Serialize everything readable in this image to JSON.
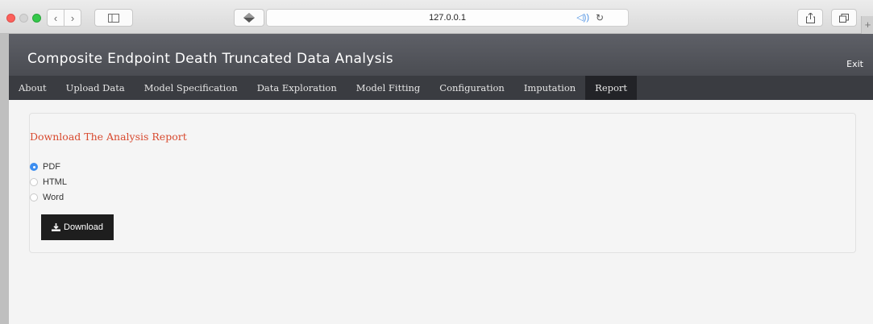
{
  "browser": {
    "url": "127.0.0.1"
  },
  "app": {
    "title": "Composite Endpoint Death Truncated Data Analysis",
    "exit_label": "Exit",
    "tabs": [
      {
        "label": "About"
      },
      {
        "label": "Upload Data"
      },
      {
        "label": "Model Specification"
      },
      {
        "label": "Data Exploration"
      },
      {
        "label": "Model Fitting"
      },
      {
        "label": "Configuration"
      },
      {
        "label": "Imputation"
      },
      {
        "label": "Report",
        "active": true
      }
    ]
  },
  "report": {
    "title": "Download The Analysis Report",
    "options": [
      {
        "label": "PDF",
        "selected": true
      },
      {
        "label": "HTML",
        "selected": false
      },
      {
        "label": "Word",
        "selected": false
      }
    ],
    "download_label": "Download"
  }
}
